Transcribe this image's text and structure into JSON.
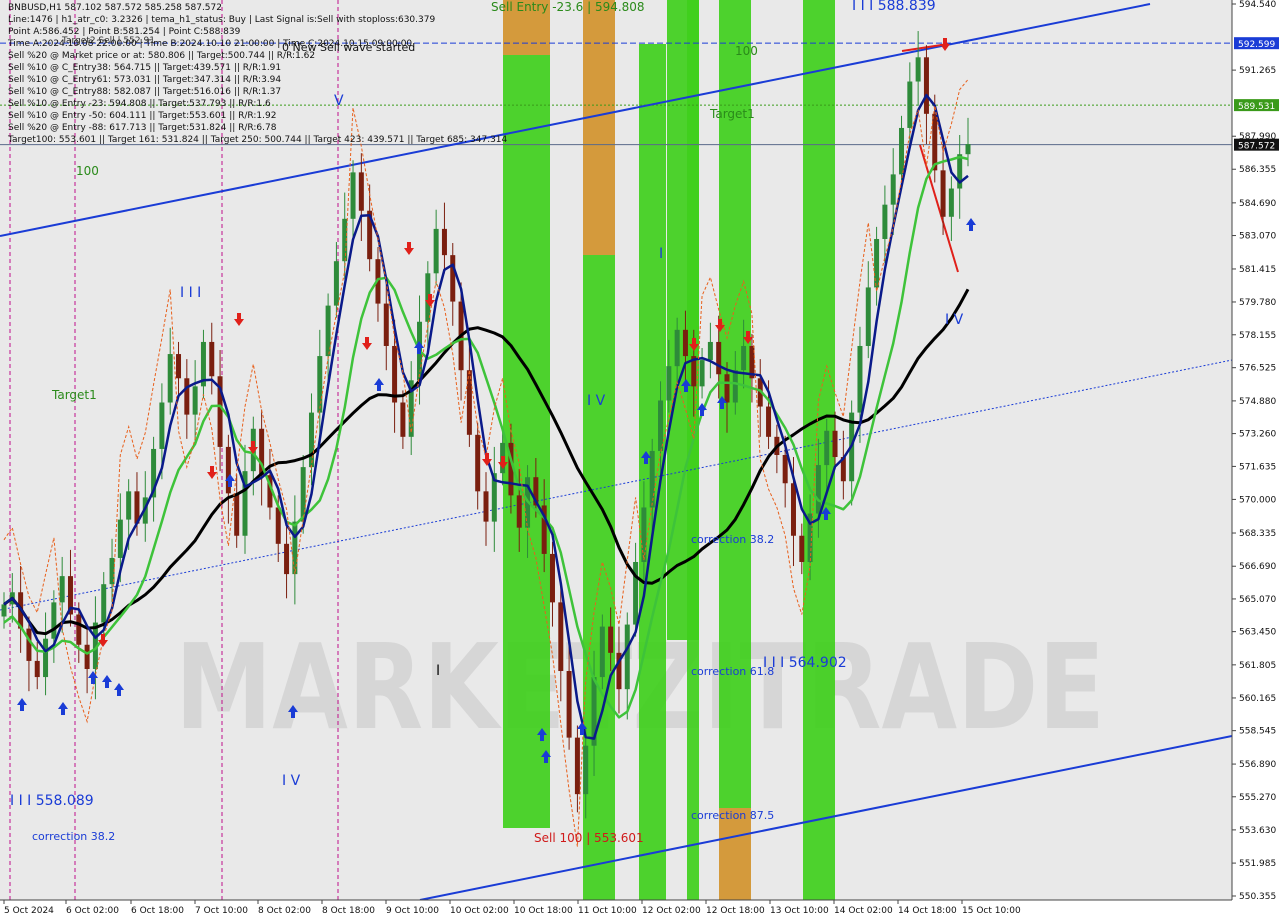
{
  "chart_data": {
    "type": "candlestick",
    "symbol": "BNBUSD",
    "timeframe": "H1",
    "ylim": [
      550.355,
      594.54
    ],
    "y_ticks": [
      "594.540",
      "592.599",
      "591.265",
      "589.531",
      "587.990",
      "587.572",
      "586.355",
      "584.690",
      "583.070",
      "581.415",
      "579.780",
      "578.155",
      "576.525",
      "574.880",
      "573.260",
      "571.635",
      "570.000",
      "568.335",
      "566.690",
      "565.070",
      "563.450",
      "561.805",
      "560.165",
      "558.545",
      "556.890",
      "555.270",
      "553.630",
      "551.985",
      "550.355"
    ],
    "x_ticks": [
      "5 Oct 2024",
      "6 Oct 02:00",
      "6 Oct 18:00",
      "7 Oct 10:00",
      "8 Oct 02:00",
      "8 Oct 18:00",
      "9 Oct 10:00",
      "10 Oct 02:00",
      "10 Oct 18:00",
      "11 Oct 10:00",
      "12 Oct 02:00",
      "12 Oct 18:00",
      "13 Oct 10:00",
      "14 Oct 02:00",
      "14 Oct 18:00",
      "15 Oct 10:00"
    ],
    "ohlc_legend": "BNBUSD,H1  587.102 587.572 585.258 587.572",
    "last_price": 587.572,
    "price_tags": [
      {
        "value": 592.599,
        "label": "592.599",
        "color": "#1a3cd6"
      },
      {
        "value": 589.531,
        "label": "589.531",
        "color": "#3a9a1a"
      },
      {
        "value": 587.572,
        "label": "587.572",
        "color": "#111111"
      }
    ],
    "close_series": [
      564.8,
      565.4,
      563.6,
      562.0,
      561.2,
      563.1,
      564.9,
      566.2,
      564.3,
      562.8,
      561.6,
      563.9,
      565.8,
      567.1,
      569.0,
      570.4,
      568.8,
      570.1,
      572.5,
      574.8,
      577.2,
      576.0,
      574.2,
      575.6,
      577.8,
      576.1,
      572.6,
      570.3,
      568.2,
      571.4,
      573.5,
      571.2,
      569.6,
      567.8,
      566.3,
      568.9,
      571.6,
      574.3,
      577.1,
      579.6,
      581.8,
      583.9,
      586.2,
      584.3,
      581.9,
      579.7,
      577.6,
      574.8,
      573.1,
      575.9,
      578.8,
      581.2,
      583.4,
      582.1,
      579.8,
      576.4,
      573.2,
      570.4,
      568.9,
      571.3,
      572.8,
      570.2,
      568.6,
      571.1,
      569.7,
      567.3,
      564.9,
      561.5,
      558.2,
      555.4,
      557.8,
      561.2,
      563.7,
      562.4,
      560.6,
      563.8,
      566.9,
      569.6,
      572.4,
      574.9,
      576.6,
      578.4,
      577.1,
      575.6,
      576.9,
      577.8,
      576.2,
      574.8,
      576.4,
      577.6,
      576.0,
      574.6,
      573.1,
      572.2,
      570.8,
      568.2,
      566.9,
      569.3,
      571.7,
      573.4,
      572.1,
      570.9,
      574.3,
      577.6,
      580.5,
      582.9,
      584.6,
      586.1,
      588.4,
      590.7,
      591.9,
      589.1,
      586.3,
      584.0,
      585.4,
      587.1,
      587.6
    ],
    "wave_labels": [
      {
        "text": "I I I 558.089",
        "color": "#1a3cd6"
      },
      {
        "text": "I I I",
        "color": "#1a3cd6"
      },
      {
        "text": "I V",
        "color": "#1a3cd6"
      },
      {
        "text": "V",
        "color": "#1a3cd6"
      },
      {
        "text": "I V",
        "color": "#1a3cd6"
      },
      {
        "text": "I",
        "color": "#1a3cd6"
      },
      {
        "text": "I",
        "color": "#111111"
      },
      {
        "text": "I I I 564.902",
        "color": "#1a3cd6"
      },
      {
        "text": "I I I 588.839",
        "color": "#1a3cd6"
      },
      {
        "text": "I V",
        "color": "#1a3cd6"
      }
    ],
    "annotations": {
      "sell_entry": "Sell Entry -23.6 | 594.808",
      "sell_100": "Sell 100 | 553.601",
      "target1_left": "Target1",
      "target1_right": "Target1",
      "level_100_left": "100",
      "level_100_right": "100",
      "correction_38_left": "correction 38.2",
      "correction_38": "correction 38.2",
      "correction_61": "correction 61.8",
      "correction_87": "correction 87.5",
      "new_sell_wave": "0 New Sell wave started",
      "target2_sell": "Target2 Sell | 552.91"
    },
    "colors": {
      "background": "#e9e9e9",
      "bull": "#2e8b3a",
      "bear": "#7a1f0f",
      "zone_green": "#3fcf1c",
      "zone_orange": "#e0953e",
      "channel": "#1a3cd6",
      "ma_black": "#000000",
      "ma_green": "#3ec33a",
      "ma_navy": "#0a1a8a",
      "signal_up": "#1a3cd6",
      "signal_down": "#e0201a",
      "stop_dash": "#e8601c",
      "trend_red": "#e0201a",
      "watermark": "#cfcfcf"
    }
  },
  "header": {
    "line_1": "BNBUSD,H1  587.102 587.572 585.258 587.572",
    "line_2": "Line:1476 | h1_atr_c0: 3.2326 | tema_h1_status: Buy | Last Signal is:Sell with stoploss:630.379",
    "line_3": "Point A:586.452 | Point B:581.254 | Point C:588.839",
    "line_4": "Time A:2024.10.08 22:00:00 | Time B:2024.10.10 21:00:00 | Time C:2024.10.15 09:00:00",
    "line_5": "Sell %20 @ Market price or at: 580.806 || Target:500.744 || R/R:1.62",
    "line_6": "Sell %10 @ C_Entry38: 564.715 || Target:439.571 || R/R:1.91",
    "line_7": "Sell %10 @ C_Entry61: 573.031 || Target:347.314 || R/R:3.94",
    "line_8": "Sell %10 @ C_Entry88: 582.087 || Target:516.016 || R/R:1.37",
    "line_9": "Sell %10 @ Entry -23: 594.808 || Target:537.793 || R/R:1.6",
    "line_10": "Sell %10 @ Entry -50: 604.111 || Target:553.601 || R/R:1.92",
    "line_11": "Sell %20 @ Entry -88: 617.713 || Target:531.824 || R/R:6.78",
    "line_12": "Target100: 553.601 || Target 161: 531.824 || Target 250: 500.744 || Target 423: 439.571 || Target 685: 347.314"
  },
  "watermark": "MARKETZITRADE"
}
